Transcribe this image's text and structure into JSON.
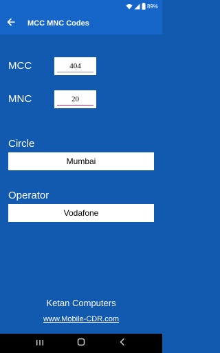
{
  "status_bar": {
    "battery": "89%",
    "icons": [
      "wifi-icon",
      "signal-icon",
      "battery-icon"
    ]
  },
  "app_bar": {
    "title": "MCC MNC Codes",
    "back_icon": "arrow-left-icon"
  },
  "form": {
    "mcc_label": "MCC",
    "mcc_value": "404",
    "mnc_label": "MNC",
    "mnc_value": "20"
  },
  "results": {
    "circle_label": "Circle",
    "circle_value": "Mumbai",
    "operator_label": "Operator",
    "operator_value": "Vodafone"
  },
  "footer": {
    "company": "Ketan Computers",
    "website": "www.Mobile-CDR.com"
  },
  "nav": {
    "icons": [
      "recents-icon",
      "home-icon",
      "back-icon"
    ]
  },
  "colors": {
    "background": "#1259b0",
    "app_bar": "#1665c8",
    "focus_underline": "#c2185b"
  }
}
